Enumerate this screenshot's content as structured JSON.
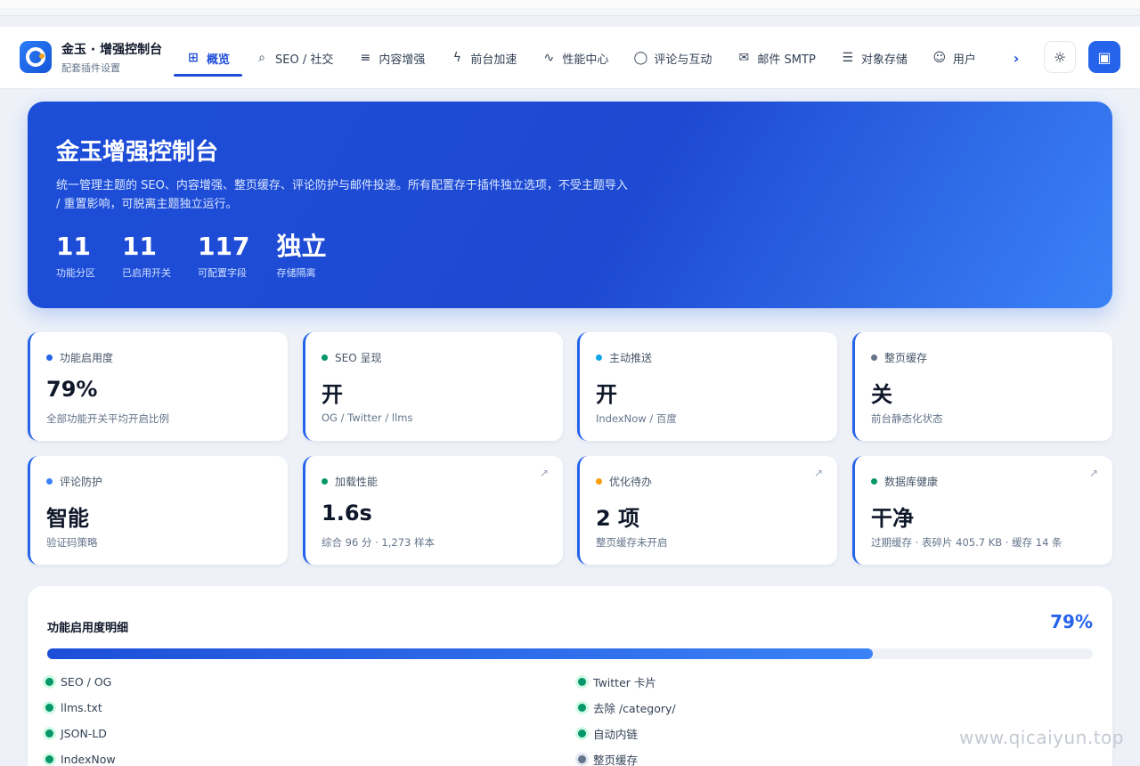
{
  "header": {
    "brand_title": "金玉 · 增强控制台",
    "brand_subtitle": "配套插件设置",
    "tabs": [
      {
        "label": "概览",
        "icon": "grid-icon",
        "active": true
      },
      {
        "label": "SEO / 社交",
        "icon": "search-icon"
      },
      {
        "label": "内容增强",
        "icon": "list-icon"
      },
      {
        "label": "前台加速",
        "icon": "bolt-icon"
      },
      {
        "label": "性能中心",
        "icon": "pulse-icon"
      },
      {
        "label": "评论与互动",
        "icon": "comment-icon"
      },
      {
        "label": "邮件 SMTP",
        "icon": "mail-icon"
      },
      {
        "label": "对象存储",
        "icon": "database-icon"
      },
      {
        "label": "用户",
        "icon": "users-icon"
      }
    ],
    "theme_icon": "sun-icon",
    "save_icon": "save-icon"
  },
  "hero": {
    "title": "金玉增强控制台",
    "description": "统一管理主题的 SEO、内容增强、整页缓存、评论防护与邮件投递。所有配置存于插件独立选项，不受主题导入 / 重置影响，可脱离主题独立运行。",
    "stats": [
      {
        "value": "11",
        "label": "功能分区"
      },
      {
        "value": "11",
        "label": "已启用开关"
      },
      {
        "value": "117",
        "label": "可配置字段"
      },
      {
        "value": "独立",
        "label": "存储隔离"
      }
    ]
  },
  "cards": [
    {
      "label": "功能启用度",
      "value": "79%",
      "note": "全部功能开关平均开启比例",
      "dot_color": "#2563eb",
      "accent": "#2563eb"
    },
    {
      "label": "SEO 呈现",
      "value": "开",
      "note": "OG / Twitter / llms",
      "dot_color": "#059669",
      "accent": "#2563eb"
    },
    {
      "label": "主动推送",
      "value": "开",
      "note": "IndexNow / 百度",
      "dot_color": "#0ea5e9",
      "accent": "#2563eb"
    },
    {
      "label": "整页缓存",
      "value": "关",
      "note": "前台静态化状态",
      "dot_color": "#64748b",
      "accent": "#2563eb"
    },
    {
      "label": "评论防护",
      "value": "智能",
      "note": "验证码策略",
      "dot_color": "#3b82f6",
      "accent": "#2563eb"
    },
    {
      "label": "加载性能",
      "value": "1.6s",
      "note": "综合 96 分 · 1,273 样本",
      "dot_color": "#059669",
      "accent": "#2563eb",
      "link": true
    },
    {
      "label": "优化待办",
      "value": "2 项",
      "note": "整页缓存未开启",
      "dot_color": "#f59e0b",
      "accent": "#2563eb",
      "link": true
    },
    {
      "label": "数据库健康",
      "value": "干净",
      "note": "过期缓存 · 表碎片 405.7 KB · 缓存 14 条",
      "dot_color": "#059669",
      "accent": "#2563eb",
      "link": true
    }
  ],
  "panel": {
    "title": "功能启用度明细",
    "percent_label": "79%",
    "percent": 79,
    "features": [
      {
        "name": "SEO / OG",
        "on": true
      },
      {
        "name": "Twitter 卡片",
        "on": true
      },
      {
        "name": "llms.txt",
        "on": true
      },
      {
        "name": "去除 /category/",
        "on": true
      },
      {
        "name": "JSON-LD",
        "on": true
      },
      {
        "name": "自动内链",
        "on": true
      },
      {
        "name": "IndexNow",
        "on": true
      },
      {
        "name": "整页缓存",
        "on": false
      }
    ]
  },
  "watermark": "www.qicaiyun.top"
}
